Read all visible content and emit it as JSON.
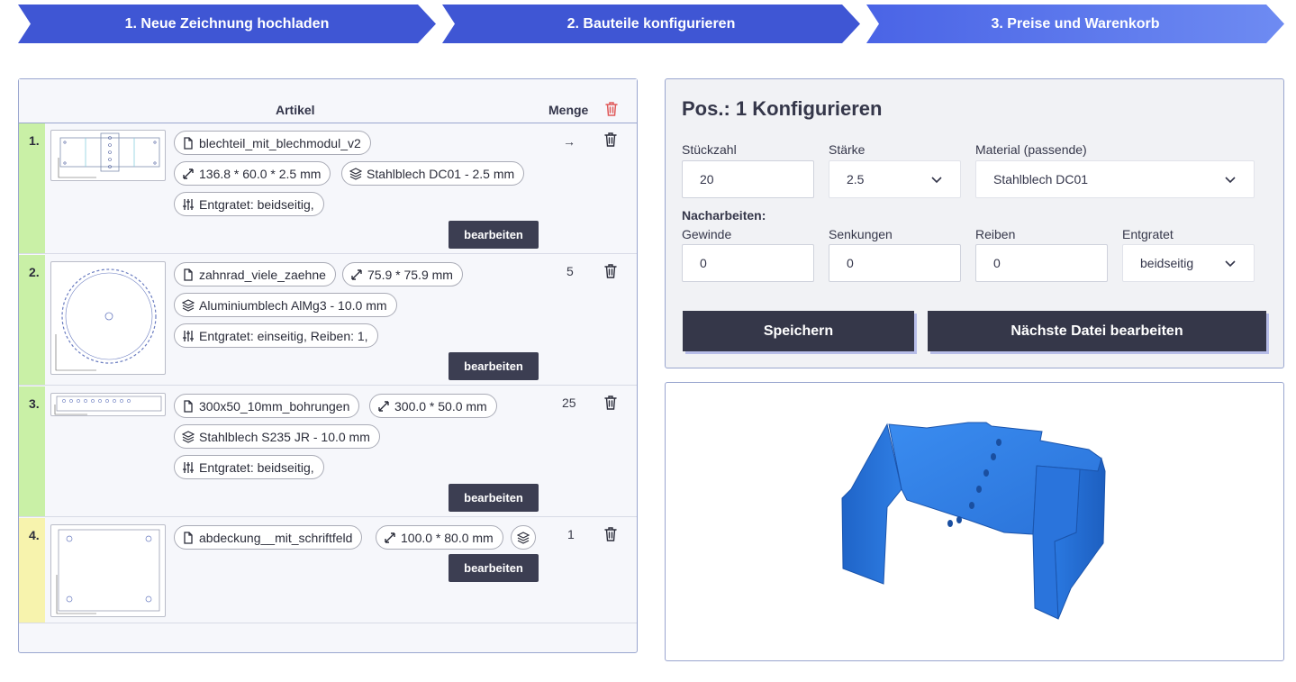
{
  "steps": [
    {
      "label": "1. Neue Zeichnung hochladen",
      "color": "#3f56d4"
    },
    {
      "label": "2. Bauteile konfigurieren",
      "color": "#3f56d4"
    },
    {
      "label": "3. Preise und Warenkorb",
      "color": "#5c78ee"
    }
  ],
  "table": {
    "header_artikel": "Artikel",
    "header_menge": "Menge",
    "edit_label": "bearbeiten",
    "rows": [
      {
        "num": "1.",
        "status_color": "#c9f0a6",
        "name": "blechteil_mit_blechmodul_v2",
        "dims": "136.8 * 60.0 * 2.5 mm",
        "material": "Stahlblech DC01 - 2.5 mm",
        "post": "Entgratet: beidseitig,",
        "qty": "→"
      },
      {
        "num": "2.",
        "status_color": "#c9f0a6",
        "name": "zahnrad_viele_zaehne",
        "dims": "75.9 * 75.9 mm",
        "material": "Aluminiumblech AlMg3 - 10.0 mm",
        "post": "Entgratet: einseitig, Reiben: 1,",
        "qty": "5"
      },
      {
        "num": "3.",
        "status_color": "#c9f0a6",
        "name": "300x50_10mm_bohrungen",
        "dims": "300.0 * 50.0 mm",
        "material": "Stahlblech S235 JR - 10.0 mm",
        "post": "Entgratet: beidseitig,",
        "qty": "25"
      },
      {
        "num": "4.",
        "status_color": "#f7f3ad",
        "name": "abdeckung__mit_schriftfeld",
        "dims": "100.0 * 80.0 mm",
        "qty": "1"
      }
    ]
  },
  "config": {
    "title": "Pos.: 1 Konfigurieren",
    "stueckzahl_label": "Stückzahl",
    "stueckzahl_value": "20",
    "staerke_label": "Stärke",
    "staerke_value": "2.5",
    "material_label": "Material (passende)",
    "material_value": "Stahlblech DC01",
    "nacharbeiten_label": "Nacharbeiten:",
    "gewinde_label": "Gewinde",
    "gewinde_value": "0",
    "senkungen_label": "Senkungen",
    "senkungen_value": "0",
    "reiben_label": "Reiben",
    "reiben_value": "0",
    "entgratet_label": "Entgratet",
    "entgratet_value": "beidseitig",
    "save_label": "Speichern",
    "next_label": "Nächste Datei bearbeiten"
  },
  "icons": {
    "file": "file-icon",
    "dims": "resize-arrows-icon",
    "material": "layers-icon",
    "post": "sliders-icon",
    "trash": "trash-icon",
    "chevron": "chevron-down-icon",
    "arrow": "arrow-right-icon"
  },
  "colors": {
    "step_dark": "#3f56d4",
    "step_light": "#5c78ee",
    "button_dark": "#353749",
    "part_blue": "#2e7be0",
    "done_green": "#c9f0a6",
    "pending_yellow": "#f7f3ad",
    "delete_red": "#e05a5a"
  }
}
